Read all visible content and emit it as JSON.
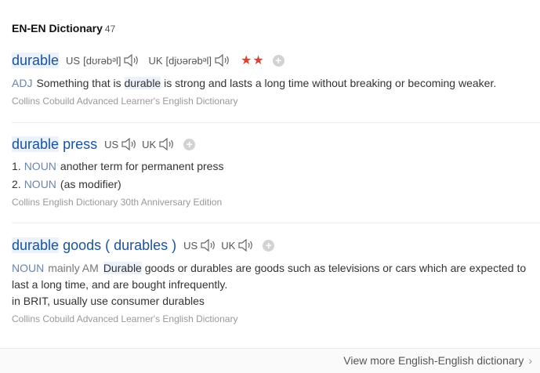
{
  "header": {
    "title": "EN-EN Dictionary",
    "count": "47"
  },
  "entries": [
    {
      "headword": "durable",
      "us_label": "US",
      "us_ipa": "[dʊrəbᵊl]",
      "uk_label": "UK",
      "uk_ipa": "[djʊərəbᵊl]",
      "stars": "★★",
      "pos": "ADJ",
      "def_pre": "Something that is",
      "def_hl": "durable",
      "def_post": "is strong and lasts a long time without breaking or becoming weaker.",
      "source": "Collins Cobuild Advanced Learner's English Dictionary"
    },
    {
      "headword_hl": "durable",
      "headword_rest": "press",
      "us_label": "US",
      "uk_label": "UK",
      "senses": [
        {
          "num": "1.",
          "pos": "NOUN",
          "text": "another term for permanent press"
        },
        {
          "num": "2.",
          "pos": "NOUN",
          "text": "(as modifier)"
        }
      ],
      "source": "Collins English Dictionary 30th Anniversary Edition"
    },
    {
      "headword_hl": "durable",
      "headword_rest": "goods ( durables )",
      "us_label": "US",
      "uk_label": "UK",
      "pos": "NOUN",
      "mainly": "mainly AM",
      "def_hl": "Durable",
      "def_line1_rest": "goods or durables are goods such as televisions or cars which are expected to",
      "def_line2": "last a long time, and are bought infrequently.",
      "def_line3": "in BRIT, usually use consumer durables",
      "source": "Collins Cobuild Advanced Learner's English Dictionary"
    }
  ],
  "footer": {
    "link": "View more English-English dictionary",
    "chevron": "›"
  },
  "colors": {
    "headword": "#1a53a0",
    "pos": "#6a84aa",
    "stars": "#e0402f",
    "source": "#999999"
  },
  "icons": {
    "speaker": "speaker-icon",
    "add": "plus-icon",
    "more": "chevron-right-icon"
  }
}
